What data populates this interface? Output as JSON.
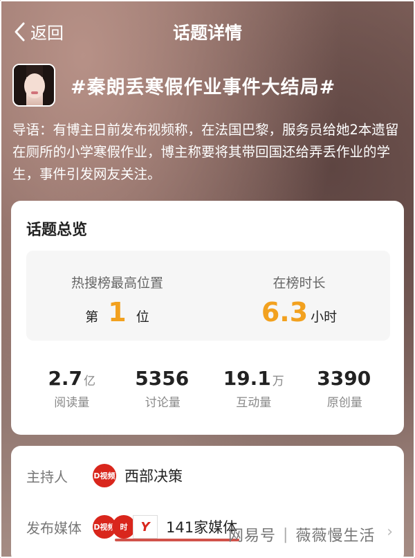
{
  "nav": {
    "back_label": "返回",
    "title": "话题详情"
  },
  "topic": {
    "title": "#秦朗丢寒假作业事件大结局#",
    "intro": "导语：有博主日前发布视频称，在法国巴黎，服务员给她2本遗留在厕所的小学寒假作业，博主称要将其带回国还给弄丢作业的学生，事件引发网友关注。"
  },
  "overview": {
    "title": "话题总览",
    "rank": {
      "label": "热搜榜最高位置",
      "prefix": "第",
      "value": "1",
      "suffix": "位"
    },
    "duration": {
      "label": "在榜时长",
      "value": "6.3",
      "unit": "小时"
    },
    "stats": [
      {
        "value": "2.7",
        "unit": "亿",
        "label": "阅读量"
      },
      {
        "value": "5356",
        "unit": "",
        "label": "讨论量"
      },
      {
        "value": "19.1",
        "unit": "万",
        "label": "互动量"
      },
      {
        "value": "3390",
        "unit": "",
        "label": "原创量"
      }
    ]
  },
  "info": {
    "host_label": "主持人",
    "host_logo_text": "D视频",
    "host_value": "西部决策",
    "media_label": "发布媒体",
    "media_logo1_text": "D视频",
    "media_logo2_text": "时",
    "media_logo3_text": "Y",
    "media_value": "141家媒体",
    "chevron": "›"
  },
  "watermark": {
    "left": "网易号",
    "sep": "|",
    "right": "薇薇慢生活"
  },
  "colors": {
    "accent_orange": "#f2a11f",
    "brand_red": "#d9261c"
  }
}
